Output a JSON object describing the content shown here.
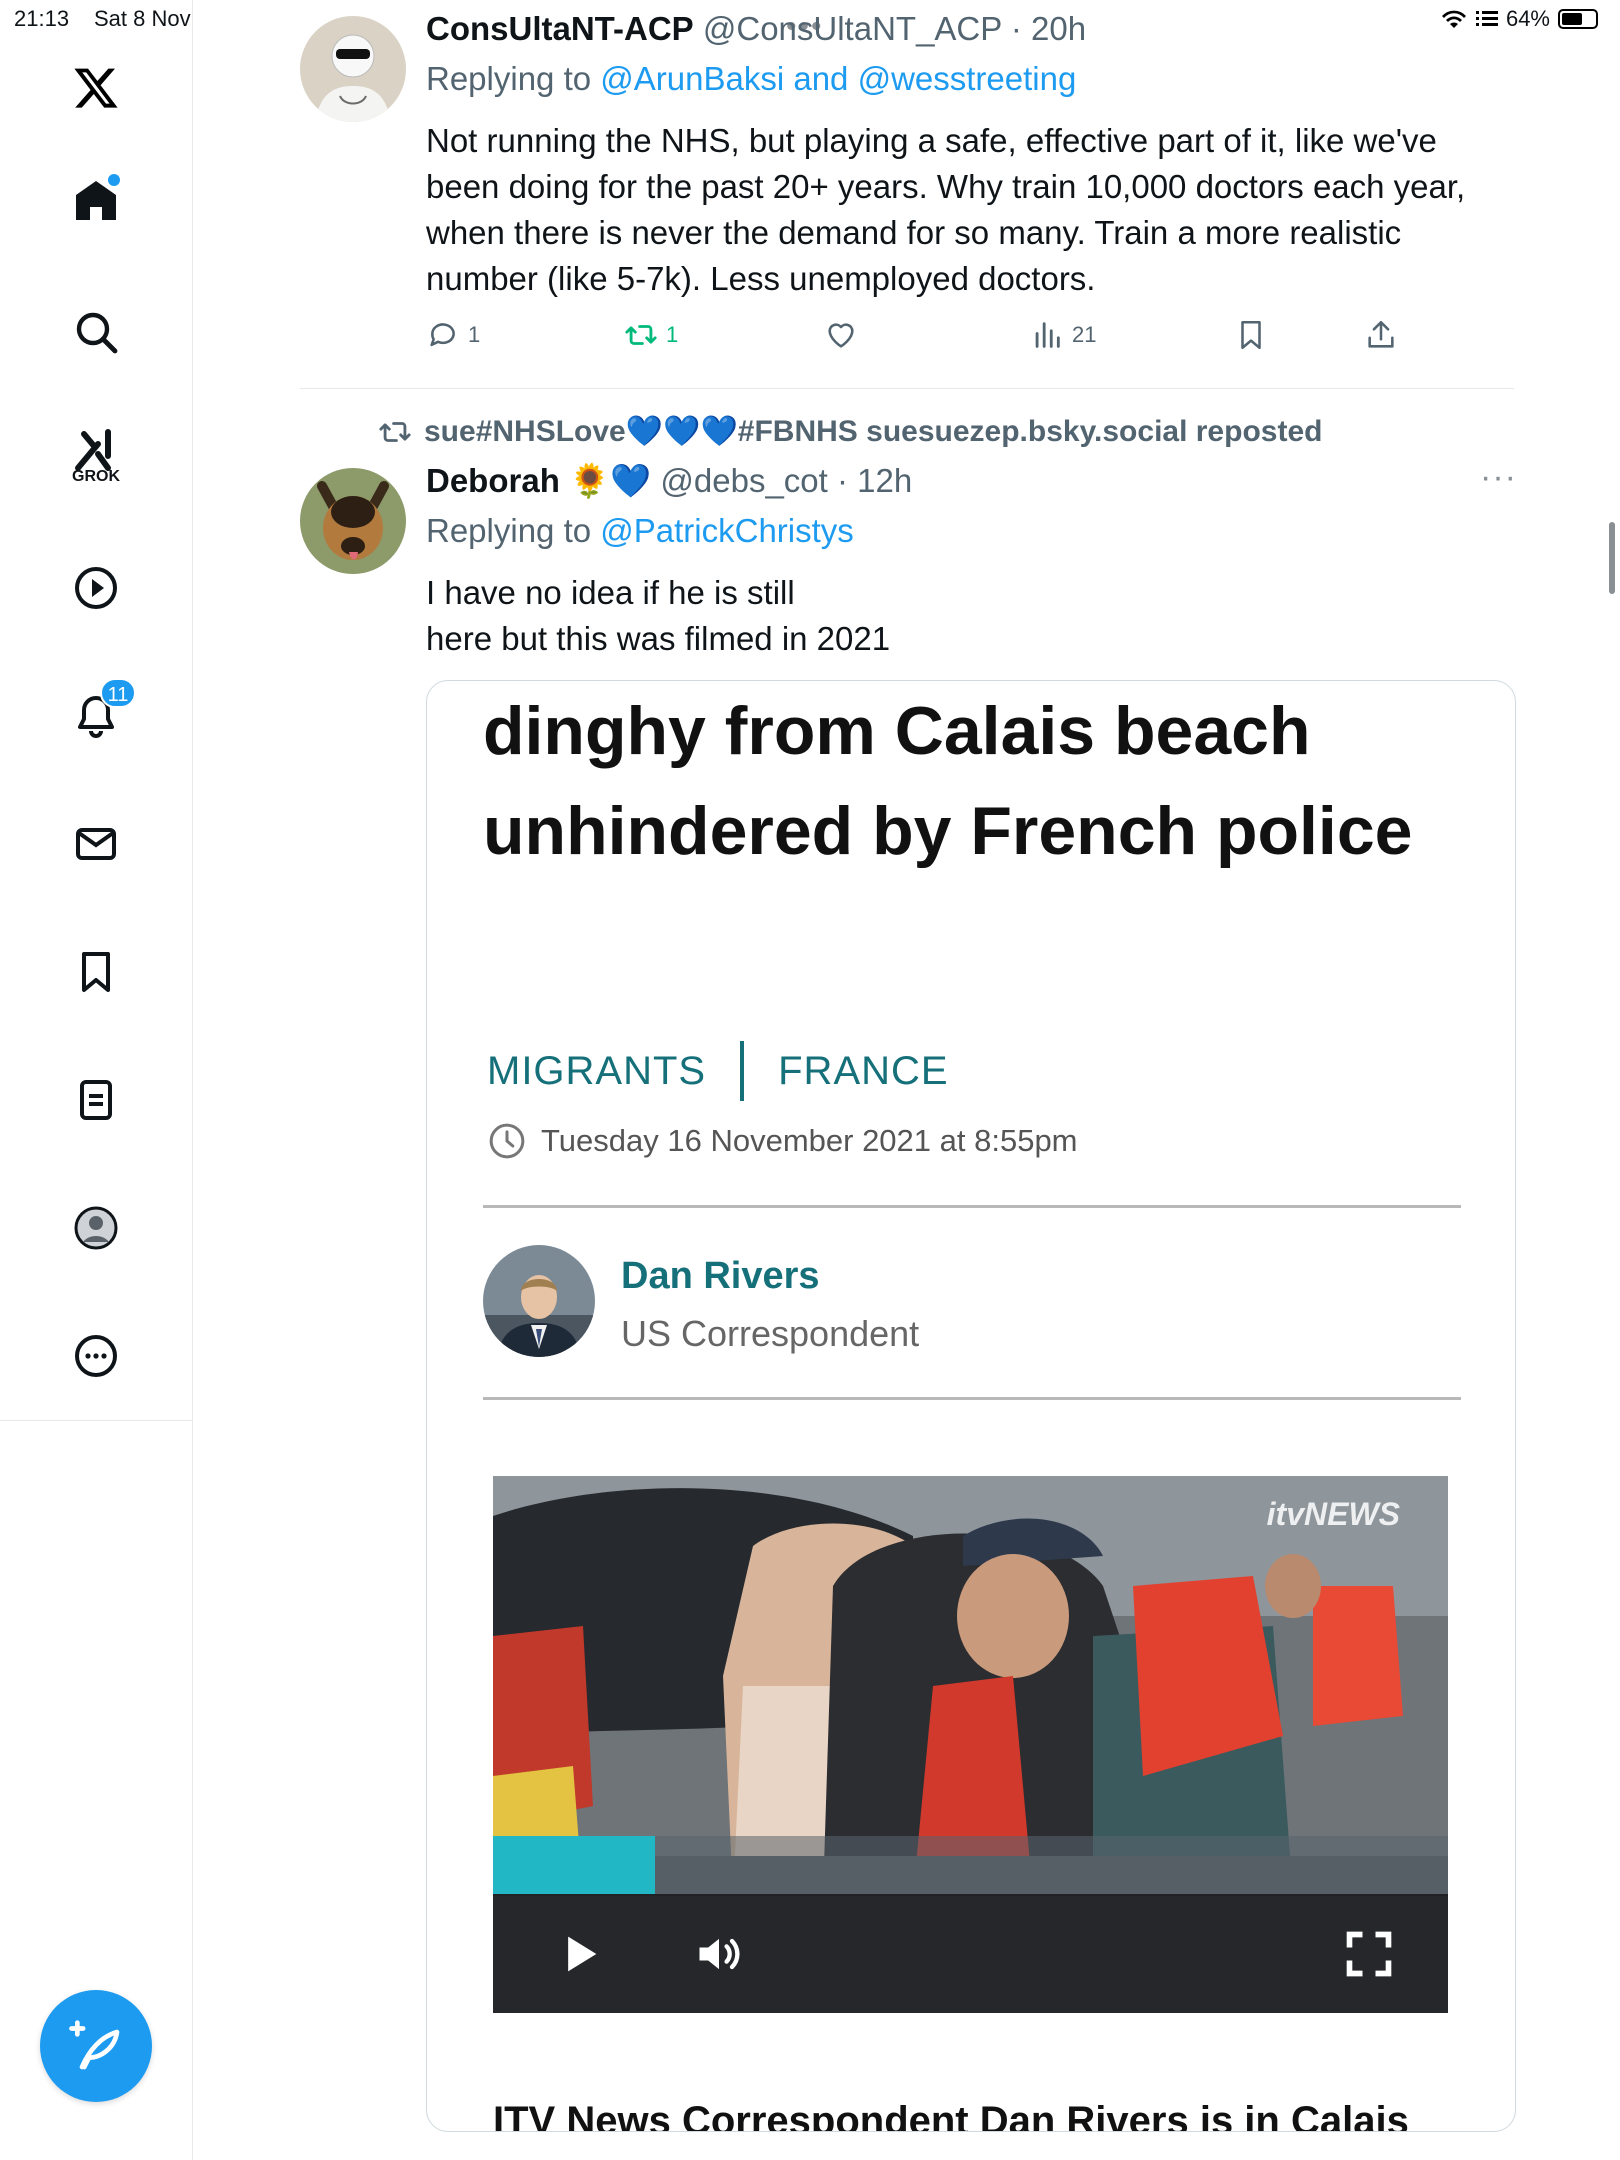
{
  "status_bar": {
    "time": "21:13",
    "date": "Sat 8 Nov",
    "battery_percent": "64%",
    "battery_level": 0.64
  },
  "sidebar": {
    "logo": "x-logo-icon",
    "items": [
      {
        "name": "home",
        "icon": "home-icon",
        "has_dot": true
      },
      {
        "name": "explore",
        "icon": "search-icon"
      },
      {
        "name": "grok",
        "icon": "grok-icon",
        "label": "GROK"
      },
      {
        "name": "video",
        "icon": "play-icon"
      },
      {
        "name": "notifications",
        "icon": "bell-icon",
        "badge": "11"
      },
      {
        "name": "messages",
        "icon": "mail-icon"
      },
      {
        "name": "bookmarks",
        "icon": "bookmark-icon"
      },
      {
        "name": "lists",
        "icon": "list-icon"
      },
      {
        "name": "profile",
        "icon": "profile-icon"
      },
      {
        "name": "more",
        "icon": "more-icon"
      }
    ],
    "compose_icon": "compose-icon"
  },
  "tweet1": {
    "name": "ConsUltaNT-ACP",
    "handle": "@ConsUltaNT_ACP",
    "time": "20h",
    "replying_prefix": "Replying to ",
    "replying_to_1": "@ArunBaksi",
    "replying_and": " and ",
    "replying_to_2": "@wesstreeting",
    "text": "Not running the NHS, but playing a safe, effective part of it, like we've been doing for the past 20+ years. Why train 10,000 doctors each year, when there is never the demand for so many. Train a more realistic number (like 5-7k). Less unemployed doctors.",
    "replies": "1",
    "reposts": "1",
    "views": "21"
  },
  "tweet2": {
    "repost_text": "sue#NHSLove💙💙💙#FBNHS suesuezep.bsky.social reposted",
    "name": "Deborah",
    "name_emoji": "🌻💙",
    "handle": "@debs_cot",
    "time": "12h",
    "replying_prefix": "Replying to ",
    "replying_to": "@PatrickChristys",
    "text_line1": "I have no idea if he is still",
    "text_line2": "here but this was filmed in 2021",
    "card": {
      "headline": "dinghy from Calais beach unhindered by French police",
      "tag1": "MIGRANTS",
      "tag2": "FRANCE",
      "date": "Tuesday 16 November 2021 at 8:55pm",
      "author": "Dan Rivers",
      "author_role": "US Correspondent",
      "video_logo": "itvNEWS",
      "video_progress": 0.17,
      "caption": "ITV News Correspondent Dan Rivers is in Calais"
    }
  },
  "colors": {
    "accent": "#1d9bf0",
    "repost_green": "#00ba7c",
    "itv_teal": "#15707a",
    "progress": "#21b7c4"
  }
}
